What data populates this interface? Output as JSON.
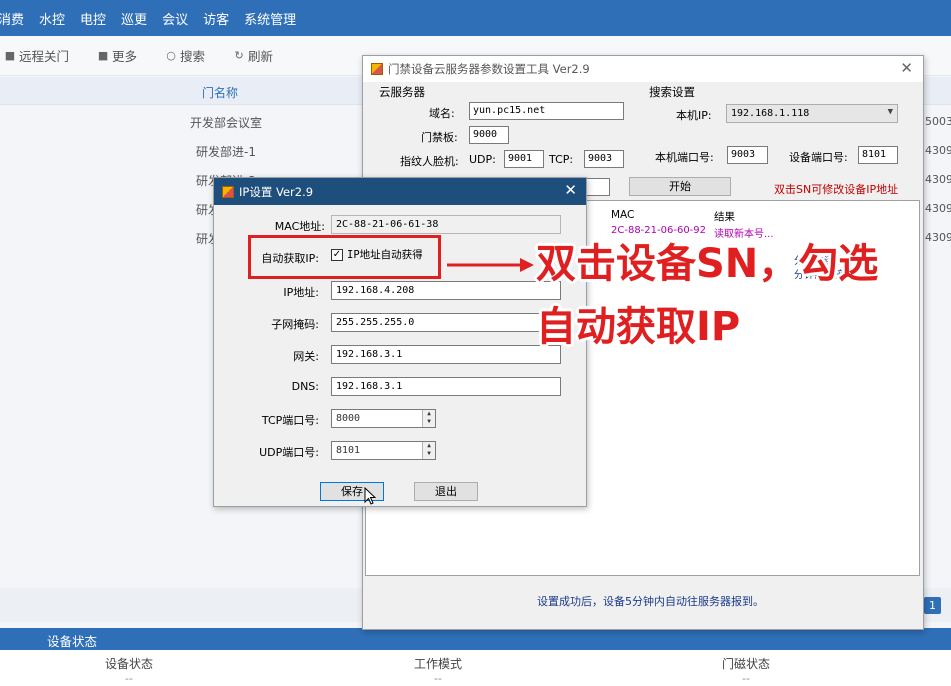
{
  "topnav": {
    "items": [
      "消费",
      "水控",
      "电控",
      "巡更",
      "会议",
      "访客",
      "系统管理"
    ]
  },
  "toolbar": {
    "buttons": [
      {
        "label": "远程关门",
        "icon": "door-icon"
      },
      {
        "label": "更多",
        "icon": "more-icon"
      },
      {
        "label": "搜索",
        "icon": "search-icon"
      },
      {
        "label": "刷新",
        "icon": "refresh-icon"
      }
    ]
  },
  "table": {
    "header": "门名称",
    "rows": [
      "开发部会议室",
      "研发部进-1",
      "研发部进-2",
      "研发",
      "研发"
    ],
    "right_values": [
      "5003",
      "4309",
      "4309",
      "4309",
      "4309"
    ]
  },
  "pagination": {
    "current": "1"
  },
  "device_status": {
    "title": "设备状态",
    "columns": [
      "设备状态",
      "工作模式",
      "门磁状态"
    ],
    "values": [
      "--",
      "--",
      "--"
    ]
  },
  "cloud_tool": {
    "title": "门禁设备云服务器参数设置工具 Ver2.9",
    "server_group": "云服务器",
    "domain_label": "域名:",
    "domain_value": "yun.pc15.net",
    "door_board_label": "门禁板:",
    "door_board_value": "9000",
    "face_label": "指纹人脸机:",
    "udp_label": "UDP:",
    "udp_value": "9001",
    "tcp_label": "TCP:",
    "tcp_value": "9003",
    "search_group": "搜索设置",
    "local_ip_label": "本机IP:",
    "local_ip_value": "192.168.1.118",
    "local_port_label": "本机端口号:",
    "local_port_value": "9003",
    "device_port_label": "设备端口号:",
    "device_port_value": "8101",
    "start_button": "开始",
    "double_click_hint": "双击SN可修改设备IP地址",
    "list_columns": [
      "MAC",
      "结果"
    ],
    "list_rows": [
      {
        "mac": "2C-88-21-06-60-92",
        "result": "读取新本号..."
      },
      {
        "mac": "",
        "result": "分钟内连接"
      },
      {
        "mac": "",
        "result": "分钟内连接"
      }
    ],
    "footer_note": "设置成功后，设备5分钟内自动往服务器报到。"
  },
  "ip_dialog": {
    "title": "IP设置 Ver2.9",
    "mac_label": "MAC地址:",
    "mac_value": "2C-88-21-06-61-38",
    "auto_ip_label": "自动获取IP:",
    "auto_ip_checkbox": "IP地址自动获得",
    "auto_ip_checked": true,
    "ip_label": "IP地址:",
    "ip_value": "192.168.4.208",
    "mask_label": "子网掩码:",
    "mask_value": "255.255.255.0",
    "gateway_label": "网关:",
    "gateway_value": "192.168.3.1",
    "dns_label": "DNS:",
    "dns_value": "192.168.3.1",
    "tcp_port_label": "TCP端口号:",
    "tcp_port_value": "8000",
    "udp_port_label": "UDP端口号:",
    "udp_port_value": "8101",
    "save_button": "保存",
    "exit_button": "退出"
  },
  "annotation": {
    "line1": "双击设备SN，勾选",
    "line2": "自动获取IP",
    "color": "#e02020"
  }
}
